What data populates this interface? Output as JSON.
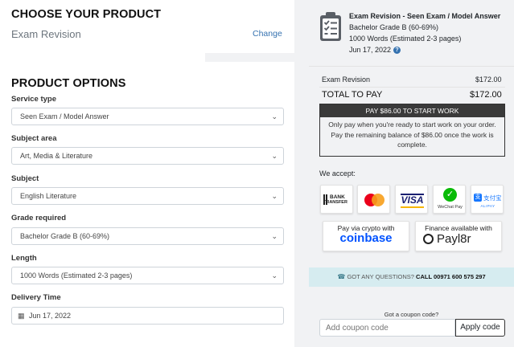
{
  "choose": {
    "title": "CHOOSE YOUR PRODUCT",
    "product": "Exam Revision",
    "change_link": "Change"
  },
  "options": {
    "title": "PRODUCT OPTIONS",
    "fields": [
      {
        "label": "Service type",
        "value": "Seen Exam / Model Answer"
      },
      {
        "label": "Subject area",
        "value": "Art, Media & Literature"
      },
      {
        "label": "Subject",
        "value": "English Literature"
      },
      {
        "label": "Grade required",
        "value": "Bachelor Grade B (60-69%)"
      },
      {
        "label": "Length",
        "value": "1000 Words (Estimated 2-3 pages)"
      },
      {
        "label": "Delivery Time",
        "value": "Jun 17, 2022"
      }
    ]
  },
  "summary": {
    "title": "Exam Revision - Seen Exam / Model Answer",
    "grade": "Bachelor Grade B (60-69%)",
    "length": "1000 Words (Estimated 2-3 pages)",
    "date": "Jun 17, 2022",
    "help": "?",
    "line_label": "Exam Revision",
    "line_price": "$172.00",
    "total_label": "TOTAL TO PAY",
    "total_price": "$172.00",
    "pay_header": "PAY $86.00 TO START WORK",
    "pay_note": "Only pay when you're ready to start work on your order. Pay the remaining balance of $86.00 once the work is complete."
  },
  "payments": {
    "we_accept": "We accept:",
    "bank_line1": "BANK",
    "bank_line2": "TRANSFER",
    "visa": "VISA",
    "wechat": "WeChat Pay",
    "alipay_cn": "支付宝",
    "alipay": "ALIPAY",
    "coinbase_top": "Pay via crypto with",
    "coinbase": "coinbase",
    "payl8r_top": "Finance available with",
    "payl8r": "Payl8r"
  },
  "contact": {
    "text": "GOT ANY QUESTIONS?",
    "phone": "CALL 00971 600 575 297"
  },
  "coupon": {
    "label": "Got a coupon code?",
    "placeholder": "Add coupon code",
    "button": "Apply code"
  },
  "colors": {
    "mastercard_red": "#eb001b",
    "mastercard_orange": "#f79e1b",
    "visa_blue": "#1a1f71",
    "wechat_green": "#09bb07",
    "alipay_blue": "#1677ff",
    "coinbase_blue": "#0052ff",
    "contact_bg": "#d6ecf0"
  }
}
